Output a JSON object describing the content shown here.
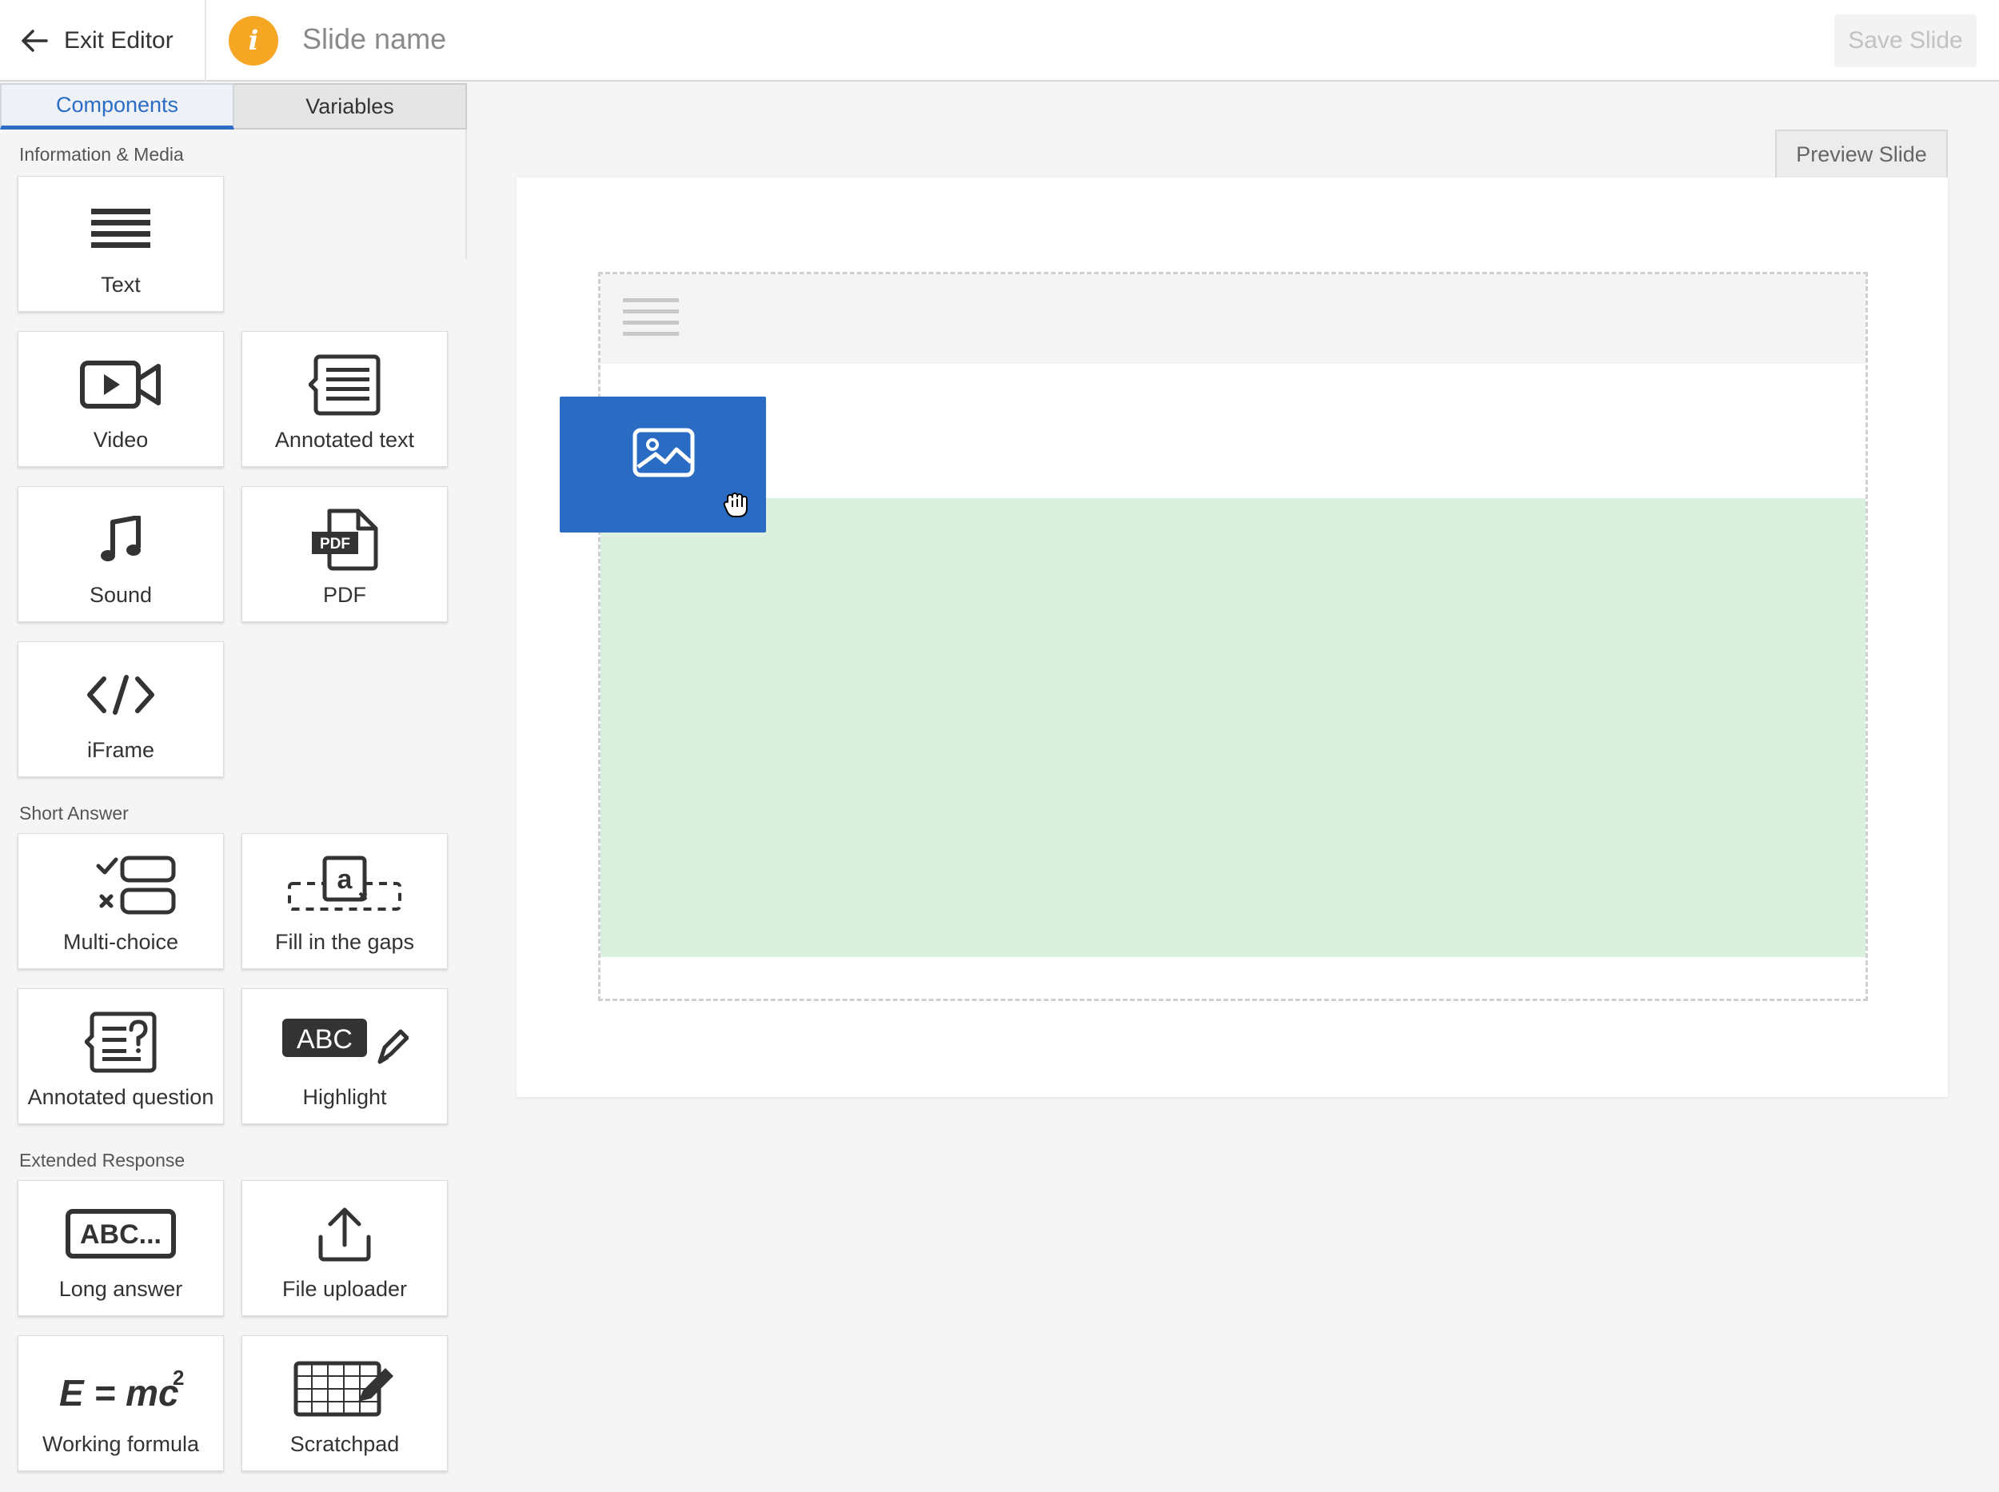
{
  "header": {
    "exit_label": "Exit Editor",
    "info_icon": "i",
    "slide_name": "Slide name",
    "save_label": "Save Slide"
  },
  "sidebar": {
    "tabs": [
      {
        "label": "Components",
        "active": true
      },
      {
        "label": "Variables",
        "active": false
      }
    ],
    "sections": [
      {
        "title": "Information & Media",
        "items": [
          {
            "label": "Text",
            "icon": "text-lines-icon"
          },
          {
            "label": "Video",
            "icon": "video-camera-icon"
          },
          {
            "label": "Annotated text",
            "icon": "annotated-text-icon"
          },
          {
            "label": "Sound",
            "icon": "music-note-icon"
          },
          {
            "label": "PDF",
            "icon": "pdf-file-icon"
          },
          {
            "label": "iFrame",
            "icon": "code-brackets-icon"
          }
        ]
      },
      {
        "title": "Short Answer",
        "items": [
          {
            "label": "Multi-choice",
            "icon": "multi-choice-icon"
          },
          {
            "label": "Fill in the gaps",
            "icon": "fill-gaps-icon"
          },
          {
            "label": "Annotated question",
            "icon": "annotated-question-icon"
          },
          {
            "label": "Highlight",
            "icon": "highlight-abc-icon"
          }
        ]
      },
      {
        "title": "Extended Response",
        "items": [
          {
            "label": "Long answer",
            "icon": "long-answer-icon"
          },
          {
            "label": "File uploader",
            "icon": "upload-icon"
          },
          {
            "label": "Working formula",
            "icon": "formula-icon"
          },
          {
            "label": "Scratchpad",
            "icon": "scratchpad-icon"
          }
        ]
      }
    ],
    "icon_glyphs": {
      "pdf_badge": "PDF",
      "fill_gaps_letter": "a",
      "highlight_text": "ABC",
      "long_answer_text": "ABC...",
      "formula_text": "E = mc",
      "formula_exp": "2"
    }
  },
  "canvas": {
    "preview_label": "Preview Slide",
    "dragged_component_icon": "image-icon",
    "cursor_icon": "grab-hand-icon"
  },
  "colors": {
    "accent": "#2b6cc4",
    "info": "#f5a623",
    "dropzone_highlight": "#dcf0df",
    "drag_card": "#2a6bc4"
  }
}
